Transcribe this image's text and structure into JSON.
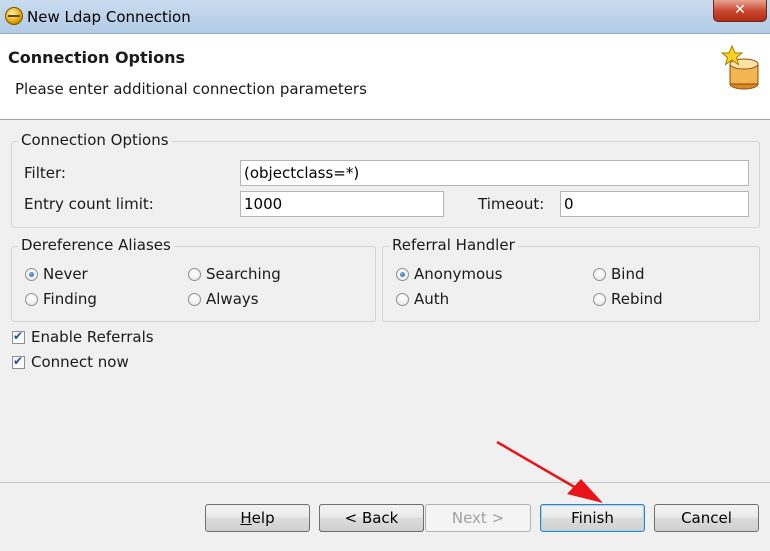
{
  "window": {
    "title": "New Ldap Connection",
    "close_glyph": "✕"
  },
  "header": {
    "title": "Connection Options",
    "subtitle": "Please enter additional connection parameters",
    "icon": "database-star-icon"
  },
  "connection_options": {
    "legend": "Connection Options",
    "filter_label": "Filter:",
    "filter_value": "(objectclass=*)",
    "count_label": "Entry count limit:",
    "count_value": "1000",
    "timeout_label": "Timeout:",
    "timeout_value": "0"
  },
  "deref": {
    "legend": "Dereference Aliases",
    "options": [
      {
        "label": "Never",
        "selected": true
      },
      {
        "label": "Searching",
        "selected": false
      },
      {
        "label": "Finding",
        "selected": false
      },
      {
        "label": "Always",
        "selected": false
      }
    ]
  },
  "referral": {
    "legend": "Referral Handler",
    "options": [
      {
        "label": "Anonymous",
        "selected": true
      },
      {
        "label": "Bind",
        "selected": false
      },
      {
        "label": "Auth",
        "selected": false
      },
      {
        "label": "Rebind",
        "selected": false
      }
    ]
  },
  "checkboxes": [
    {
      "label": "Enable Referrals",
      "checked": true
    },
    {
      "label": "Connect now",
      "checked": true
    }
  ],
  "buttons": {
    "help": "Help",
    "back": "< Back",
    "next": "Next >",
    "finish": "Finish",
    "cancel": "Cancel"
  },
  "colors": {
    "annotation_arrow": "#e8141b",
    "default_button_border": "#3c7fb1"
  }
}
